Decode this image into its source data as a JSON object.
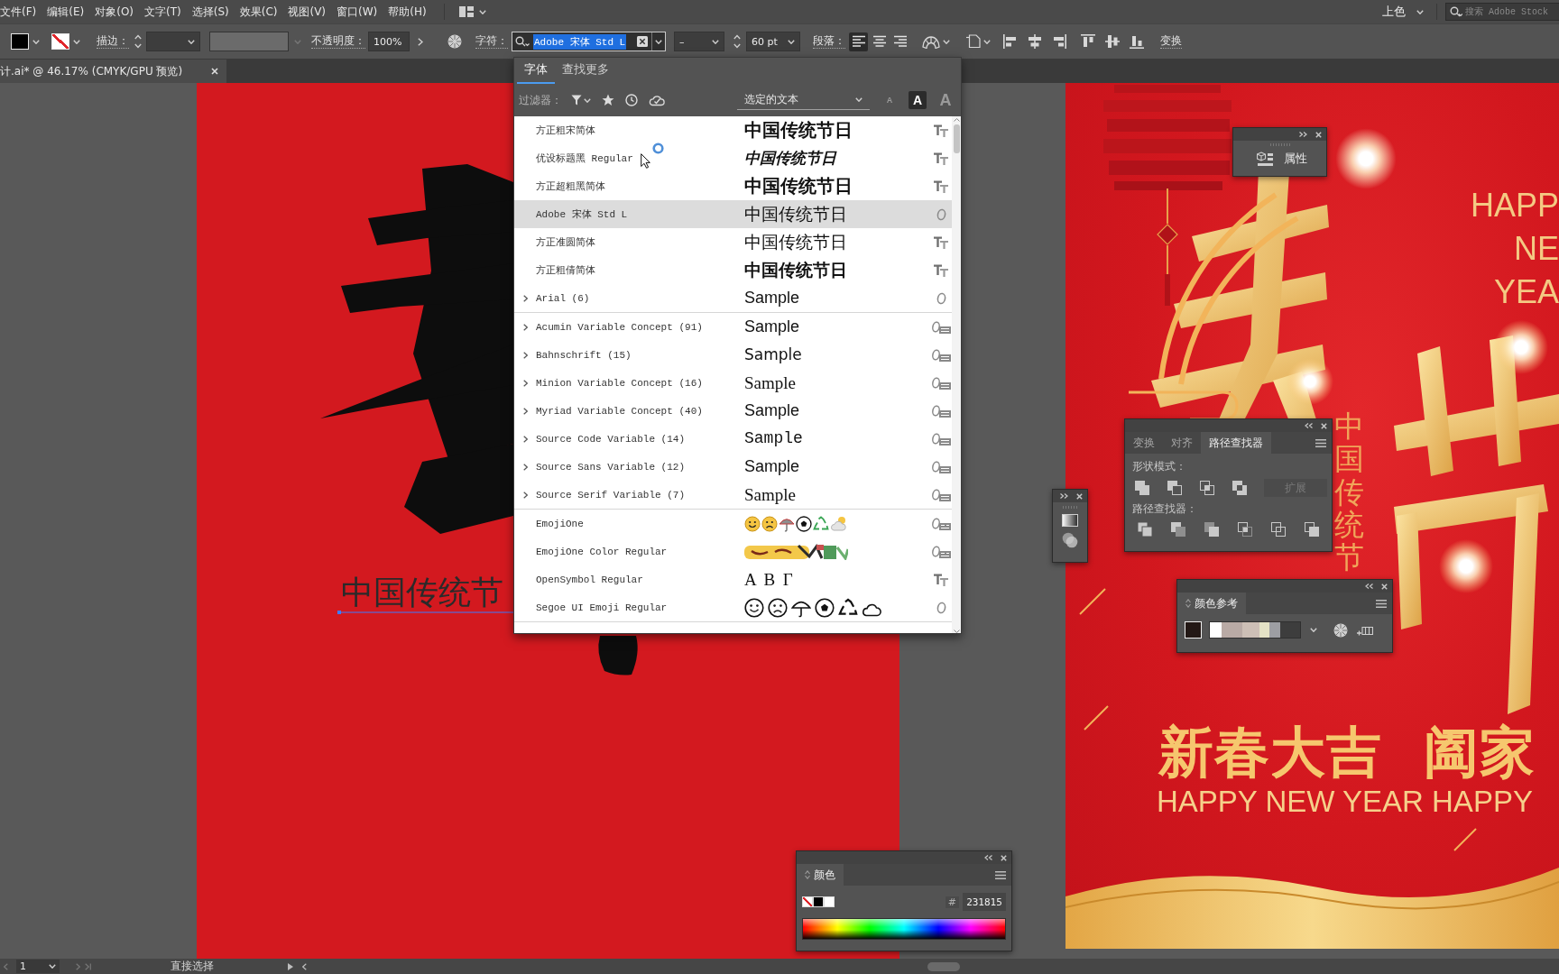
{
  "menu_bar": {
    "items": [
      "文件(F)",
      "编辑(E)",
      "对象(O)",
      "文字(T)",
      "选择(S)",
      "效果(C)",
      "视图(V)",
      "窗口(W)",
      "帮助(H)"
    ],
    "workspace": "上色",
    "search": {
      "placeholder": "搜索 Adobe Stock"
    }
  },
  "control_bar": {
    "stroke_label": "描边：",
    "opacity_label": "不透明度：",
    "opacity": "100%",
    "character_label": "字符：",
    "font_field": {
      "value": "Adobe 宋体 Std L",
      "highlighted": true
    },
    "font_style": "–",
    "font_size": "60 pt",
    "paragraph_label": "段落：",
    "paragraph_align": [
      {
        "kind": "left",
        "selected": true
      },
      {
        "kind": "center",
        "selected": false
      },
      {
        "kind": "right",
        "selected": false
      }
    ],
    "transform_label": "变换"
  },
  "document_tab": {
    "title": "计.ai* @ 46.17% (CMYK/GPU 预览)"
  },
  "font_menu": {
    "tabs": [
      {
        "label": "字体",
        "selected": true
      },
      {
        "label": "查找更多",
        "selected": false
      }
    ],
    "filter_label": "过滤器：",
    "preview_target": "选定的文本",
    "preview_sizes": [
      {
        "kind": "small",
        "label": "A",
        "selected": false
      },
      {
        "kind": "medium",
        "label": "A",
        "selected": true
      },
      {
        "kind": "large",
        "label": "A",
        "selected": false
      }
    ],
    "sections": [
      {
        "fonts": [
          {
            "name": "方正粗宋简体",
            "kind": "text",
            "sample": "中国传统节日",
            "format_icon": {
              "kind": "truetype"
            },
            "expandable": false,
            "selected": false
          },
          {
            "name": "优设标题黑 Regular",
            "kind": "text",
            "sample": "中国传统节日",
            "format_icon": {
              "kind": "truetype"
            },
            "expandable": false,
            "selected": false
          },
          {
            "name": "方正超粗黑简体",
            "kind": "text",
            "sample": "中国传统节日",
            "format_icon": {
              "kind": "truetype"
            },
            "expandable": false,
            "selected": false
          },
          {
            "name": "Adobe 宋体 Std L",
            "kind": "text",
            "sample": "中国传统节日",
            "format_icon": {
              "kind": "opentype"
            },
            "expandable": false,
            "selected": true
          },
          {
            "name": "方正准圆简体",
            "kind": "text",
            "sample": "中国传统节日",
            "format_icon": {
              "kind": "truetype"
            },
            "expandable": false,
            "selected": false
          },
          {
            "name": "方正粗倩简体",
            "kind": "text",
            "sample": "中国传统节日",
            "format_icon": {
              "kind": "truetype"
            },
            "expandable": false,
            "selected": false
          },
          {
            "name": "Arial (6)",
            "kind": "text",
            "sample": "Sample",
            "format_icon": {
              "kind": "opentype"
            },
            "expandable": true,
            "selected": false
          }
        ]
      },
      {
        "fonts": [
          {
            "name": "Acumin Variable Concept (91)",
            "kind": "text",
            "sample": "Sample",
            "format_icon": {
              "kind": "variable"
            },
            "expandable": true,
            "selected": false
          },
          {
            "name": "Bahnschrift (15)",
            "kind": "text",
            "sample": "Sample",
            "format_icon": {
              "kind": "variable"
            },
            "expandable": true,
            "selected": false
          },
          {
            "name": "Minion Variable Concept (16)",
            "kind": "text",
            "sample": "Sample",
            "format_icon": {
              "kind": "variable"
            },
            "expandable": true,
            "selected": false
          },
          {
            "name": "Myriad Variable Concept (40)",
            "kind": "text",
            "sample": "Sample",
            "format_icon": {
              "kind": "variable"
            },
            "expandable": true,
            "selected": false
          },
          {
            "name": "Source Code Variable (14)",
            "kind": "text",
            "sample": "Sample",
            "format_icon": {
              "kind": "variable"
            },
            "expandable": true,
            "selected": false
          },
          {
            "name": "Source Sans Variable (12)",
            "kind": "text",
            "sample": "Sample",
            "format_icon": {
              "kind": "variable"
            },
            "expandable": true,
            "selected": false
          },
          {
            "name": "Source Serif Variable (7)",
            "kind": "text",
            "sample": "Sample",
            "format_icon": {
              "kind": "variable"
            },
            "expandable": true,
            "selected": false
          }
        ]
      },
      {
        "fonts": [
          {
            "name": "EmojiOne",
            "kind": "emoji_color",
            "format_icon": {
              "kind": "svg"
            },
            "expandable": false,
            "selected": false
          },
          {
            "name": "EmojiOne Color Regular",
            "kind": "emoji_strip",
            "format_icon": {
              "kind": "svg"
            },
            "expandable": false,
            "selected": false
          },
          {
            "name": "OpenSymbol Regular",
            "kind": "text",
            "sample": "Α Β Γ",
            "format_icon": {
              "kind": "truetype"
            },
            "expandable": false,
            "selected": false
          },
          {
            "name": "Segoe UI Emoji Regular",
            "kind": "emoji_outline",
            "format_icon": {
              "kind": "opentype"
            },
            "expandable": false,
            "selected": false
          }
        ]
      }
    ]
  },
  "artboard_left": {
    "text": "中国传统节"
  },
  "poster": {
    "headline": [
      "HAPP",
      "NE",
      "YEA"
    ],
    "vertical_text": "中国传统节",
    "slogan": "新春大吉 阖家",
    "greeting": "HAPPY NEW YEAR HAPPY"
  },
  "properties_panel": {
    "title": "属性"
  },
  "pathfinder_panel": {
    "tabs": [
      {
        "label": "变换",
        "selected": false
      },
      {
        "label": "对齐",
        "selected": false
      },
      {
        "label": "路径查找器",
        "selected": true
      }
    ],
    "shape_modes_label": "形状模式：",
    "expand_button": {
      "label": "扩展",
      "disabled": true
    },
    "pathfinders_label": "路径查找器："
  },
  "color_guide_panel": {
    "title": "颜色参考"
  },
  "color_panel": {
    "title": "颜色",
    "hex_label": "#",
    "hex": "231815"
  },
  "status_bar": {
    "artboard": "1",
    "tool": "直接选择"
  }
}
